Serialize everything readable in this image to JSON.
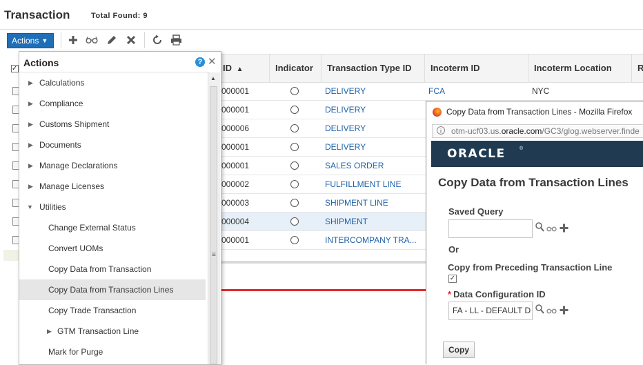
{
  "header": {
    "title": "Transaction",
    "total_found": "Total Found: 9"
  },
  "toolbar": {
    "actions_label": "Actions"
  },
  "grid": {
    "columns": [
      "ID",
      "Indicator",
      "Transaction Type ID",
      "Incoterm ID",
      "Incoterm Location",
      "R"
    ],
    "rows": [
      {
        "id": "000001",
        "type": "DELIVERY",
        "incoterm": "FCA",
        "location": "NYC"
      },
      {
        "id": "000001",
        "type": "DELIVERY",
        "incoterm": "",
        "location": ""
      },
      {
        "id": "000006",
        "type": "DELIVERY",
        "incoterm": "",
        "location": ""
      },
      {
        "id": "000001",
        "type": "DELIVERY",
        "incoterm": "",
        "location": ""
      },
      {
        "id": "000001",
        "type": "SALES ORDER",
        "incoterm": "",
        "location": ""
      },
      {
        "id": "000002",
        "type": "FULFILLMENT LINE",
        "incoterm": "",
        "location": ""
      },
      {
        "id": "000003",
        "type": "SHIPMENT LINE",
        "incoterm": "",
        "location": ""
      },
      {
        "id": "000004",
        "type": "SHIPMENT",
        "incoterm": "",
        "location": ""
      },
      {
        "id": "000001",
        "type": "INTERCOMPANY TRA...",
        "incoterm": "",
        "location": ""
      }
    ]
  },
  "actions_panel": {
    "title": "Actions",
    "items": [
      {
        "label": "Calculations"
      },
      {
        "label": "Compliance"
      },
      {
        "label": "Customs Shipment"
      },
      {
        "label": "Documents"
      },
      {
        "label": "Manage Declarations"
      },
      {
        "label": "Manage Licenses"
      },
      {
        "label": "Utilities"
      },
      {
        "label": "Change External Status"
      },
      {
        "label": "Convert UOMs"
      },
      {
        "label": "Copy Data from Transaction"
      },
      {
        "label": "Copy Data from Transaction Lines"
      },
      {
        "label": "Copy Trade Transaction"
      },
      {
        "label": "GTM Transaction Line"
      },
      {
        "label": "Mark for Purge"
      }
    ]
  },
  "browser": {
    "window_title": "Copy Data from Transaction Lines - Mozilla Firefox",
    "url_prefix": "otm-ucf03.us.",
    "url_domain": "oracle.com",
    "url_suffix": "/GC3/glog.webserver.finde",
    "brand": "ORACLE"
  },
  "dialog": {
    "title": "Copy Data from Transaction Lines",
    "saved_query_label": "Saved Query",
    "saved_query_value": "",
    "or_label": "Or",
    "copy_preceding_label": "Copy from Preceding Transaction Line",
    "data_config_label": "Data Configuration ID",
    "data_config_value": "FA - LL - DEFAULT D",
    "copy_button": "Copy"
  },
  "colors": {
    "accent": "#1f6fb8",
    "link": "#1f62a8",
    "highlight_line": "#e02a2a",
    "oracle_bar": "#203a52"
  }
}
